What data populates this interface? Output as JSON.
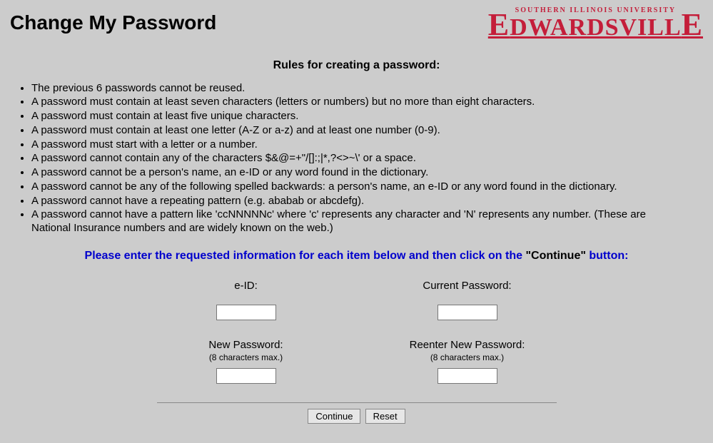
{
  "header": {
    "title": "Change My Password",
    "logo_small": "SOUTHERN ILLINOIS UNIVERSITY",
    "logo_big_cap": "E",
    "logo_big_rest": "DWARDSVILL",
    "logo_big_cap2": "E"
  },
  "rules": {
    "heading": "Rules for creating a password:",
    "items": [
      "The previous 6 passwords cannot be reused.",
      "A password must contain at least seven characters (letters or numbers) but no more than eight characters.",
      "A password must contain at least five unique characters.",
      "A password must contain at least one letter (A-Z or a-z) and at least one number (0-9).",
      "A password must start with a letter or a number.",
      "A password cannot contain any of the characters $&@=+\"/[]:;|*,?<>~\\' or a space.",
      "A password cannot be a person's name, an e-ID or any word found in the dictionary.",
      "A password cannot be any of the following spelled backwards: a person's name, an e-ID or any word found in the dictionary.",
      "A password cannot have a repeating pattern (e.g. ababab or abcdefg).",
      "A password cannot have a pattern like 'ccNNNNNc' where 'c' represents any character and 'N' represents any number. (These are National Insurance numbers and are widely known on the web.)"
    ]
  },
  "instruction": {
    "prefix": "Please enter the requested information for each item below and then click on the ",
    "continue_quoted": "\"Continue\"",
    "suffix": " button:"
  },
  "form": {
    "eid_label": "e-ID:",
    "current_label": "Current Password:",
    "new_label": "New Password:",
    "reenter_label": "Reenter New Password:",
    "max_hint": "(8 characters max.)"
  },
  "buttons": {
    "continue": "Continue",
    "reset": "Reset"
  }
}
